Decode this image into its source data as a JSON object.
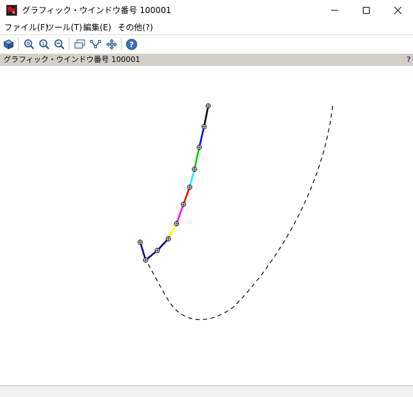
{
  "window": {
    "title": "グラフィック・ウインドウ番号 100001",
    "controls": {
      "minimize": "minimize-icon",
      "maximize": "maximize-icon",
      "close": "close-icon"
    }
  },
  "menu": [
    {
      "label": "ファイル(F)"
    },
    {
      "label": "ツール(T)"
    },
    {
      "label": "編集(E)"
    },
    {
      "label": "その他(?)"
    }
  ],
  "toolbar": {
    "buttons": [
      "rotate-3d-icon",
      "zoom-in-icon",
      "zoom-area-icon",
      "zoom-out-icon",
      "datatip-icon",
      "edit-curve-icon",
      "pan-icon",
      "help-icon"
    ]
  },
  "infobar": {
    "text": "グラフィック・ウインドウ番号 100001",
    "help": "?"
  },
  "plot": {
    "dashed_curve_color": "#000000",
    "segment_colors": [
      "#000000",
      "#0000ff",
      "#00cc00",
      "#00ffff",
      "#ff0000",
      "#ff00ff",
      "#ffff00",
      "#00008b"
    ],
    "marker": "circle-plus"
  },
  "statusbar": {
    "text": ""
  }
}
